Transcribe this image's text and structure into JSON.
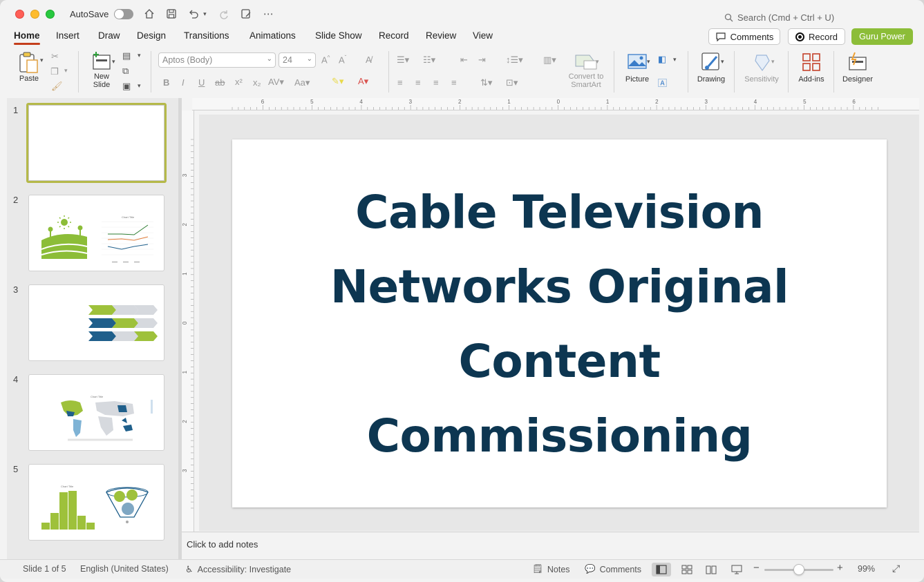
{
  "titlebar": {
    "autosave_label": "AutoSave",
    "search_placeholder": "Search (Cmd + Ctrl + U)"
  },
  "menu": {
    "tabs": [
      "Home",
      "Insert",
      "Draw",
      "Design",
      "Transitions",
      "Animations",
      "Slide Show",
      "Record",
      "Review",
      "View"
    ],
    "active_tab": "Home",
    "comments_label": "Comments",
    "record_label": "Record",
    "guru_label": "Guru Power"
  },
  "ribbon": {
    "paste": "Paste",
    "new_slide": "New Slide",
    "new_slide_line1": "New",
    "new_slide_line2": "Slide",
    "font_name": "Aptos (Body)",
    "font_size": "24",
    "convert_line1": "Convert to",
    "convert_line2": "SmartArt",
    "picture": "Picture",
    "drawing": "Drawing",
    "sensitivity": "Sensitivity",
    "addins": "Add-ins",
    "designer": "Designer"
  },
  "thumbnails": [
    {
      "num": "1",
      "selected": true
    },
    {
      "num": "2",
      "selected": false,
      "chart_title": "Chart Title"
    },
    {
      "num": "3",
      "selected": false
    },
    {
      "num": "4",
      "selected": false,
      "chart_title": "Chart Title"
    },
    {
      "num": "5",
      "selected": false,
      "chart_title": "Chart Title"
    }
  ],
  "slide": {
    "title_lines": [
      "Cable Television",
      "Networks Original",
      "Content",
      "Commissioning"
    ]
  },
  "ruler": {
    "h_labels": [
      "6",
      "5",
      "4",
      "3",
      "2",
      "1",
      "0",
      "1",
      "2",
      "3",
      "4",
      "5",
      "6"
    ],
    "v_labels": [
      "3",
      "2",
      "1",
      "0",
      "1",
      "2",
      "3"
    ]
  },
  "notes_placeholder": "Click to add notes",
  "status": {
    "slide_counter": "Slide 1 of 5",
    "language": "English (United States)",
    "accessibility": "Accessibility: Investigate",
    "notes": "Notes",
    "comments": "Comments",
    "zoom": "99%"
  },
  "colors": {
    "accent_green": "#8cbd38",
    "title_navy": "#0d3651",
    "tab_underline": "#c43e1c"
  }
}
